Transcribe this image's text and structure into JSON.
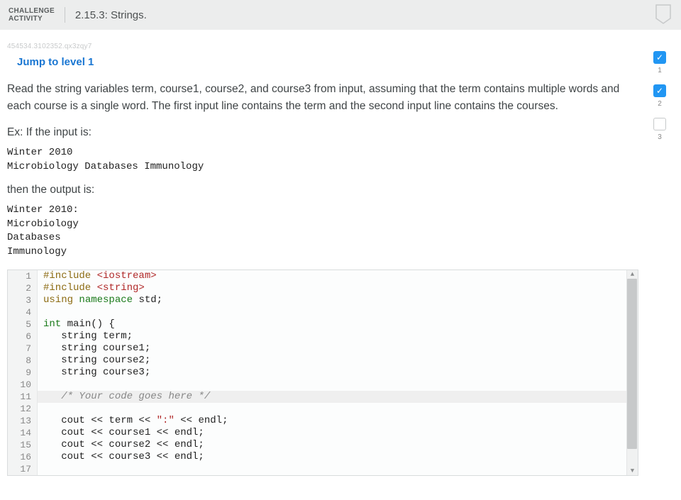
{
  "header": {
    "label_line1": "CHALLENGE",
    "label_line2": "ACTIVITY",
    "title": "2.15.3: Strings."
  },
  "idcode": "454534.3102352.qx3zqy7",
  "jump_link": "Jump to level 1",
  "instructions": "Read the string variables term, course1, course2, and course3 from input, assuming that the term contains multiple words and each course is a single word. The first input line contains the term and the second input line contains the courses.",
  "example_label": "Ex: If the input is:",
  "example_input": "Winter 2010\nMicrobiology Databases Immunology",
  "then_label": "then the output is:",
  "example_output": "Winter 2010:\nMicrobiology\nDatabases\nImmunology",
  "progress": [
    {
      "num": "1",
      "done": true
    },
    {
      "num": "2",
      "done": true
    },
    {
      "num": "3",
      "done": false
    }
  ],
  "code": {
    "active_line": 11,
    "lines": [
      {
        "n": 1,
        "tokens": [
          [
            "kw-pre",
            "#include"
          ],
          [
            "default",
            " "
          ],
          [
            "kw-str",
            "<iostream>"
          ]
        ]
      },
      {
        "n": 2,
        "tokens": [
          [
            "kw-pre",
            "#include"
          ],
          [
            "default",
            " "
          ],
          [
            "kw-str",
            "<string>"
          ]
        ]
      },
      {
        "n": 3,
        "tokens": [
          [
            "kw-pre",
            "using"
          ],
          [
            "default",
            " "
          ],
          [
            "kw-type",
            "namespace"
          ],
          [
            "default",
            " std;"
          ]
        ]
      },
      {
        "n": 4,
        "tokens": []
      },
      {
        "n": 5,
        "tokens": [
          [
            "kw-type",
            "int"
          ],
          [
            "default",
            " main() {"
          ]
        ]
      },
      {
        "n": 6,
        "tokens": [
          [
            "default",
            "   string term;"
          ]
        ]
      },
      {
        "n": 7,
        "tokens": [
          [
            "default",
            "   string course1;"
          ]
        ]
      },
      {
        "n": 8,
        "tokens": [
          [
            "default",
            "   string course2;"
          ]
        ]
      },
      {
        "n": 9,
        "tokens": [
          [
            "default",
            "   string course3;"
          ]
        ]
      },
      {
        "n": 10,
        "tokens": []
      },
      {
        "n": 11,
        "tokens": [
          [
            "default",
            "   "
          ],
          [
            "kw-cmt",
            "/* Your code goes here */"
          ]
        ]
      },
      {
        "n": 12,
        "tokens": []
      },
      {
        "n": 13,
        "tokens": [
          [
            "default",
            "   cout << term << "
          ],
          [
            "kw-str",
            "\":\""
          ],
          [
            "default",
            " << endl;"
          ]
        ]
      },
      {
        "n": 14,
        "tokens": [
          [
            "default",
            "   cout << course1 << endl;"
          ]
        ]
      },
      {
        "n": 15,
        "tokens": [
          [
            "default",
            "   cout << course2 << endl;"
          ]
        ]
      },
      {
        "n": 16,
        "tokens": [
          [
            "default",
            "   cout << course3 << endl;"
          ]
        ]
      },
      {
        "n": 17,
        "tokens": []
      }
    ]
  }
}
